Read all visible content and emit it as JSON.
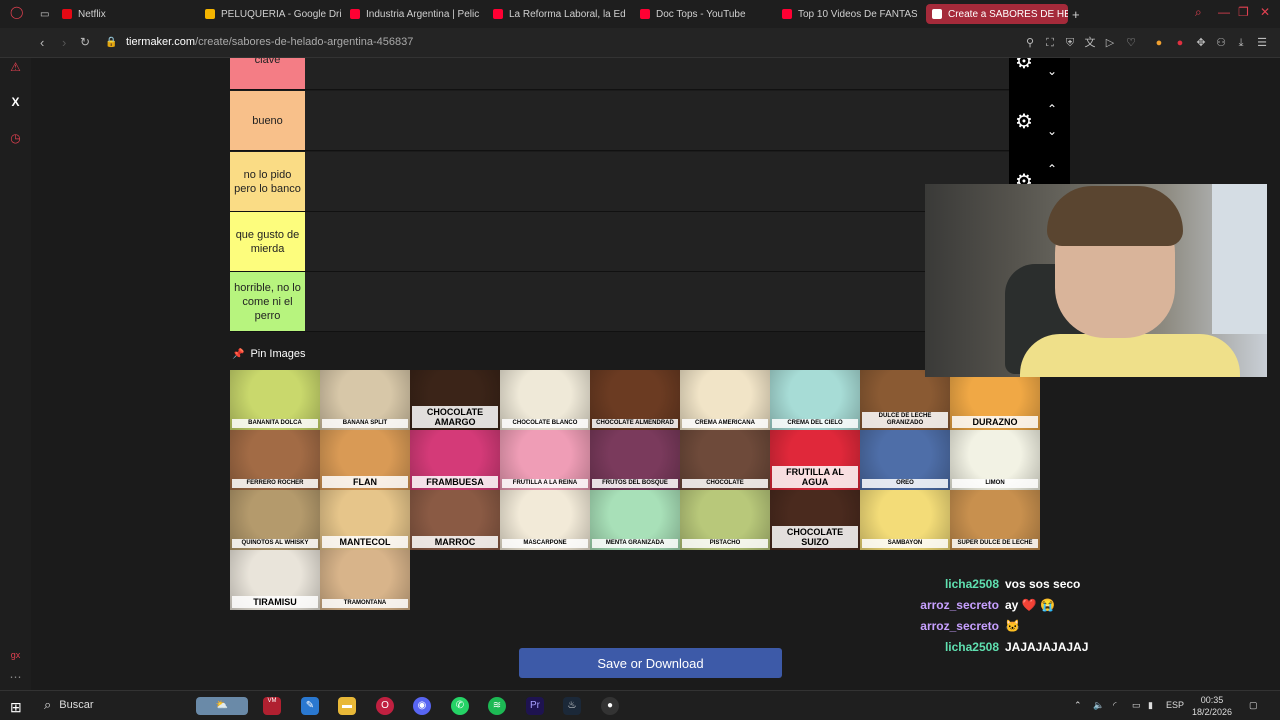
{
  "browser": {
    "tabs": [
      {
        "label": "Netflix",
        "icon_color": "#e50914",
        "active": false
      },
      {
        "label": "PELUQUERIA - Google Dri",
        "icon_color": "#f4b400",
        "active": false
      },
      {
        "label": "Industria Argentina | Pelic",
        "icon_color": "#ff0033",
        "active": false
      },
      {
        "label": "La Reforma Laboral, la Ed",
        "icon_color": "#ff0033",
        "active": false
      },
      {
        "label": "Doc Tops - YouTube",
        "icon_color": "#ff0033",
        "active": false
      },
      {
        "label": "Top 10 Videos De FANTAS",
        "icon_color": "#ff0033",
        "active": false
      },
      {
        "label": "Create a SABORES DE HEl",
        "icon_color": "#ffffff",
        "active": true
      }
    ],
    "url_host": "tiermaker.com",
    "url_path": "/create/sabores-de-helado-argentina-456837"
  },
  "tiers": [
    {
      "label": "clave",
      "color": "#f47d85"
    },
    {
      "label": "bueno",
      "color": "#f8c08a"
    },
    {
      "label": "no lo pido pero lo banco",
      "color": "#fadc85"
    },
    {
      "label": "que gusto de mierda",
      "color": "#fdfd7d"
    },
    {
      "label": "horrible, no lo come ni el perro",
      "color": "#b7f47e"
    }
  ],
  "pin_images_title": "Pin Images",
  "flavors": [
    {
      "label": "BANANITA DOLCA",
      "color": "#c9d86c"
    },
    {
      "label": "BANANA SPLIT",
      "color": "#d7c7a8"
    },
    {
      "label": "CHOCOLATE AMARGO",
      "color": "#3b2418"
    },
    {
      "label": "CHOCOLATE BLANCO",
      "color": "#efe9d8"
    },
    {
      "label": "CHOCOLATE ALMENDRAD",
      "color": "#6b3b22"
    },
    {
      "label": "CREMA AMERICANA",
      "color": "#f1e4c7"
    },
    {
      "label": "CREMA DEL CIELO",
      "color": "#a7dcd6"
    },
    {
      "label": "DULCE DE LECHE GRANIZADO",
      "color": "#8a5a33"
    },
    {
      "label": "DURAZNO",
      "color": "#f0a845"
    },
    {
      "label": "FERRERO ROCHER",
      "color": "#a26b45"
    },
    {
      "label": "FLAN",
      "color": "#d99a55"
    },
    {
      "label": "FRAMBUESA",
      "color": "#d43a78"
    },
    {
      "label": "FRUTILLA A LA REINA",
      "color": "#ef9db6"
    },
    {
      "label": "FRUTOS DEL BOSQUE",
      "color": "#7a3a5c"
    },
    {
      "label": "CHOCOLATE",
      "color": "#6e4a3a"
    },
    {
      "label": "FRUTILLA AL AGUA",
      "color": "#e0283a"
    },
    {
      "label": "OREO",
      "color": "#4e6ea8"
    },
    {
      "label": "LIMON",
      "color": "#f2f2e4"
    },
    {
      "label": "QUINOTOS AL WHISKY",
      "color": "#b49a6c"
    },
    {
      "label": "MANTECOL",
      "color": "#e6c58a"
    },
    {
      "label": "MARROC",
      "color": "#8a5a44"
    },
    {
      "label": "MASCARPONE",
      "color": "#f2ead8"
    },
    {
      "label": "MENTA GRANIZADA",
      "color": "#a8e0b8"
    },
    {
      "label": "PISTACHO",
      "color": "#b8c87a"
    },
    {
      "label": "CHOCOLATE SUIZO",
      "color": "#4a2a1e"
    },
    {
      "label": "SAMBAYON",
      "color": "#f3dc78"
    },
    {
      "label": "SUPER DULCE DE LECHE",
      "color": "#c8904e"
    },
    {
      "label": "TIRAMISU",
      "color": "#e9e4da"
    },
    {
      "label": "TRAMONTANA",
      "color": "#d8b48a"
    }
  ],
  "save_button": "Save or Download",
  "chat": [
    {
      "user": "licha2508",
      "user_color": "#5fe0b0",
      "message": "vos sos seco"
    },
    {
      "user": "arroz_secreto",
      "user_color": "#c7a0ff",
      "message": "ay ❤️ 😭"
    },
    {
      "user": "arroz_secreto",
      "user_color": "#c7a0ff",
      "message": "🐱"
    },
    {
      "user": "licha2508",
      "user_color": "#5fe0b0",
      "message": "JAJAJAJAJAJ"
    }
  ],
  "taskbar": {
    "search": "Buscar",
    "lang": "ESP",
    "time": "00:35",
    "date": "18/2/2026"
  }
}
